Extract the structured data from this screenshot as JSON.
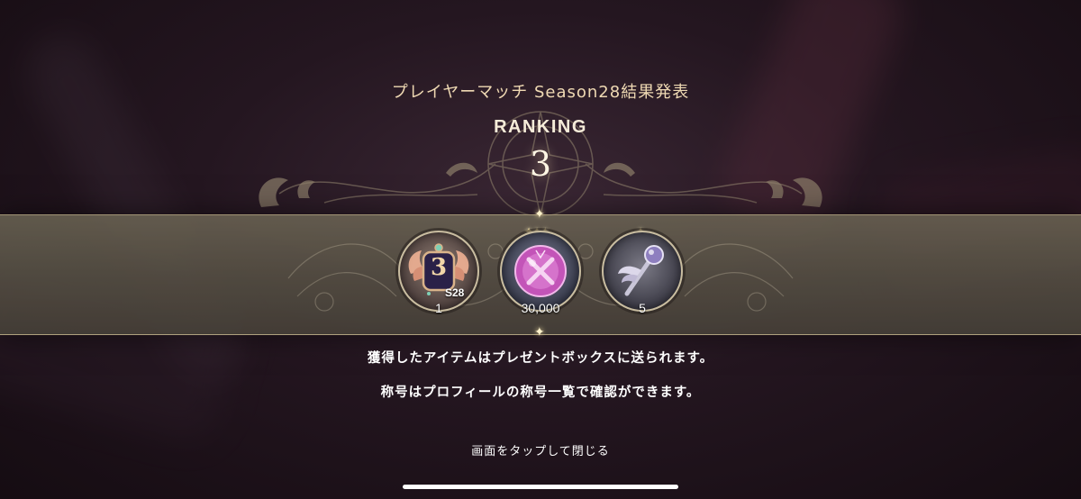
{
  "header": {
    "title": "プレイヤーマッチ Season28結果発表",
    "ranking_label": "RANKING",
    "rank_value": "3"
  },
  "rewards": [
    {
      "icon": "rank-title-emblem-icon",
      "badge_number": "3",
      "season_tag": "S28",
      "count": "1"
    },
    {
      "icon": "pink-gem-icon",
      "count": "30,000"
    },
    {
      "icon": "winged-wand-icon",
      "count": "5"
    }
  ],
  "messages": {
    "line1": "獲得したアイテムはプレゼントボックスに送られます。",
    "line2": "称号はプロフィールの称号一覧で確認ができます。"
  },
  "footer": {
    "tap_to_close": "画面をタップして閉じる"
  },
  "colors": {
    "accent_gold": "#efd9b3",
    "band": "#5f5848",
    "background": "#241620"
  }
}
